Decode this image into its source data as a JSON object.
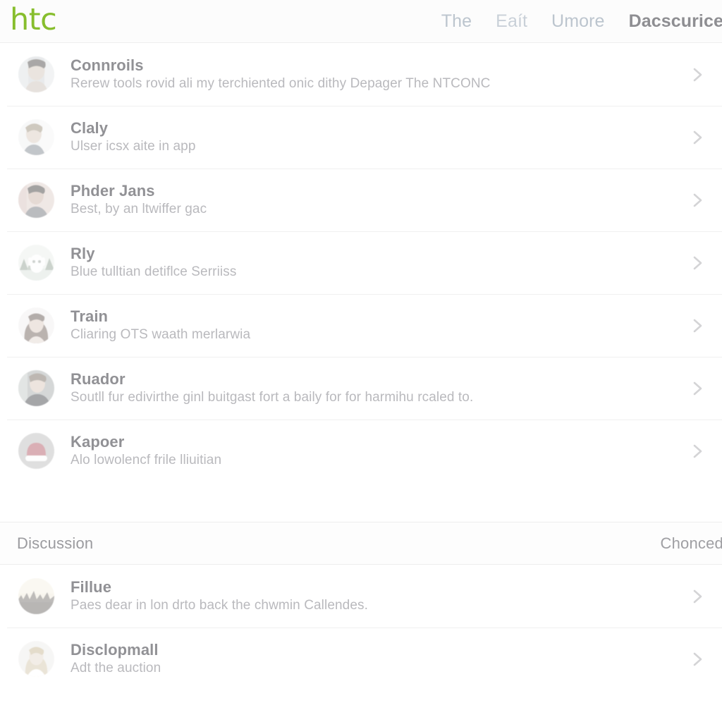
{
  "header": {
    "brand": "htc",
    "brand_color": "#83bb26",
    "nav": [
      {
        "label": "The",
        "state": "normal"
      },
      {
        "label": "Eaít",
        "state": "faded"
      },
      {
        "label": "Umore",
        "state": "normal"
      },
      {
        "label": "Dacscurice",
        "state": "active"
      }
    ]
  },
  "list": {
    "rows": [
      {
        "title": "Connroils",
        "subtitle": "Rerew tools rovid ali my terchiented onic dithy Depager The NTCONC",
        "avatar": "person-portrait-avatar",
        "chevron": "chevron-right-icon"
      },
      {
        "title": "Claly",
        "subtitle": "Ulser icsx aite in app",
        "avatar": "person-portrait-avatar",
        "chevron": "chevron-right-icon"
      },
      {
        "title": "Phder Jans",
        "subtitle": "Best, by an ltwiffer gac",
        "avatar": "person-portrait-avatar",
        "chevron": "chevron-right-icon"
      },
      {
        "title": "Rly",
        "subtitle": "Blue tulltian detiflce Serriiss",
        "avatar": "mascot-illustration-avatar",
        "chevron": "chevron-right-icon"
      },
      {
        "title": "Train",
        "subtitle": "Cliaring OTS waath merlarwia",
        "avatar": "person-portrait-avatar",
        "chevron": "chevron-right-icon"
      },
      {
        "title": "Ruador",
        "subtitle": "Soutll fur edivirthe ginl buitgast fort a baily for for harmihu rcaled to.",
        "avatar": "person-portrait-avatar",
        "chevron": "chevron-right-icon"
      },
      {
        "title": "Kapoer",
        "subtitle": "Alo lowolencf frile lliuitian",
        "avatar": "red-cap-illustration-avatar",
        "chevron": "chevron-right-icon"
      }
    ]
  },
  "section": {
    "title": "Discussion",
    "action": "Chonced"
  },
  "discussion": {
    "rows": [
      {
        "title": "Fillue",
        "subtitle": "Paes dear in lon drto back the chwmin Callendes.",
        "avatar": "skyline-photo-avatar",
        "chevron": "chevron-right-icon"
      },
      {
        "title": "Disclopmall",
        "subtitle": "Adt the auction",
        "avatar": "person-portrait-avatar",
        "chevron": "chevron-right-icon"
      }
    ]
  }
}
